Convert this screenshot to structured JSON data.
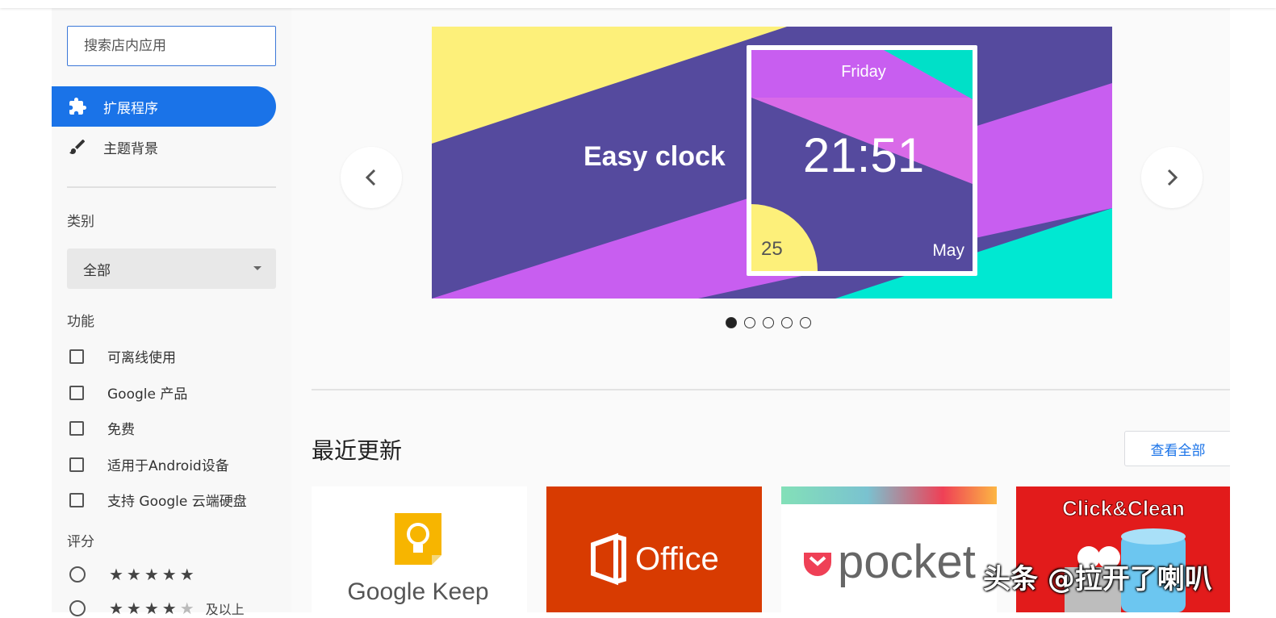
{
  "sidebar": {
    "search_placeholder": "搜索店内应用",
    "nav": [
      {
        "label": "扩展程序",
        "active": true,
        "icon": "puzzle-icon"
      },
      {
        "label": "主题背景",
        "active": false,
        "icon": "brush-icon"
      }
    ],
    "category_label": "类别",
    "category_value": "全部",
    "features_label": "功能",
    "features": [
      "可离线使用",
      "Google 产品",
      "免费",
      "适用于Android设备",
      "支持 Google 云端硬盘"
    ],
    "rating_label": "评分",
    "rating_options": [
      {
        "stars": 5,
        "suffix": ""
      },
      {
        "stars": 4,
        "suffix": "及以上"
      }
    ]
  },
  "banner": {
    "title": "Easy clock",
    "day": "Friday",
    "time": "21:51",
    "date": "25",
    "month": "May",
    "slides": 5,
    "active_slide": 1
  },
  "section": {
    "title": "最近更新",
    "view_all": "查看全部"
  },
  "cards": [
    {
      "name": "Google Keep",
      "bg": "#ffffff"
    },
    {
      "name": "Office",
      "bg": "#d83b01"
    },
    {
      "name": "pocket",
      "bg": "#ffffff"
    },
    {
      "name": "Click&Clean",
      "bg": "#e21b1b"
    }
  ],
  "watermark": "头条 @拉开了喇叭",
  "colors": {
    "accent": "#1a73e8",
    "banner_purple": "#554a9e",
    "banner_yellow": "#fdf07a",
    "banner_pink": "#d05ee8",
    "banner_cyan": "#00e8d2"
  }
}
